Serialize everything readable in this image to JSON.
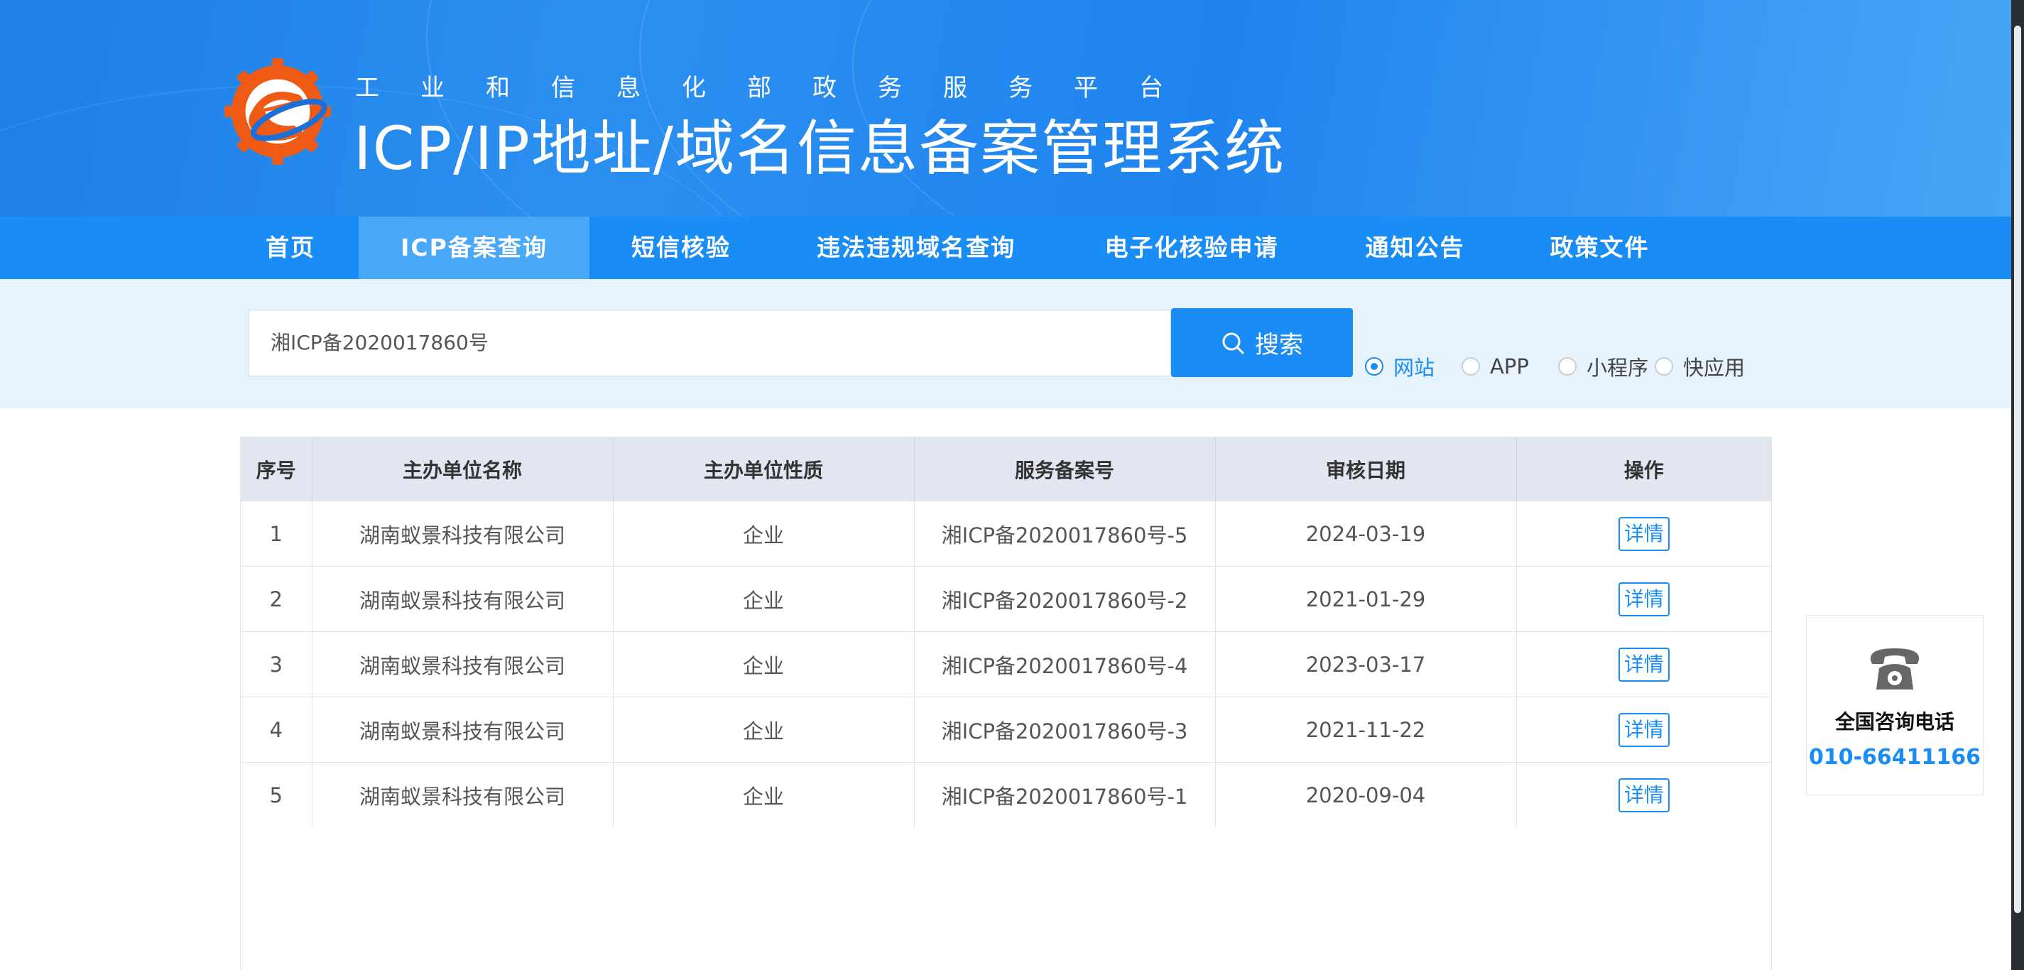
{
  "header": {
    "subtitle": "工业和信息化部政务服务平台",
    "title": "ICP/IP地址/域名信息备案管理系统"
  },
  "nav": {
    "items": [
      {
        "label": "首页",
        "active": false
      },
      {
        "label": "ICP备案查询",
        "active": true
      },
      {
        "label": "短信核验",
        "active": false
      },
      {
        "label": "违法违规域名查询",
        "active": false
      },
      {
        "label": "电子化核验申请",
        "active": false
      },
      {
        "label": "通知公告",
        "active": false
      },
      {
        "label": "政策文件",
        "active": false
      }
    ]
  },
  "search": {
    "value": "湘ICP备2020017860号",
    "button_label": "搜索",
    "options": [
      {
        "label": "网站",
        "checked": true
      },
      {
        "label": "APP",
        "checked": false
      },
      {
        "label": "小程序",
        "checked": false
      },
      {
        "label": "快应用",
        "checked": false
      }
    ]
  },
  "table": {
    "headers": [
      "序号",
      "主办单位名称",
      "主办单位性质",
      "服务备案号",
      "审核日期",
      "操作"
    ],
    "rows": [
      {
        "index": "1",
        "org": "湖南蚁景科技有限公司",
        "type": "企业",
        "record": "湘ICP备2020017860号-5",
        "date": "2024-03-19",
        "action": "详情"
      },
      {
        "index": "2",
        "org": "湖南蚁景科技有限公司",
        "type": "企业",
        "record": "湘ICP备2020017860号-2",
        "date": "2021-01-29",
        "action": "详情"
      },
      {
        "index": "3",
        "org": "湖南蚁景科技有限公司",
        "type": "企业",
        "record": "湘ICP备2020017860号-4",
        "date": "2023-03-17",
        "action": "详情"
      },
      {
        "index": "4",
        "org": "湖南蚁景科技有限公司",
        "type": "企业",
        "record": "湘ICP备2020017860号-3",
        "date": "2021-11-22",
        "action": "详情"
      },
      {
        "index": "5",
        "org": "湖南蚁景科技有限公司",
        "type": "企业",
        "record": "湘ICP备2020017860号-1",
        "date": "2020-09-04",
        "action": "详情"
      }
    ]
  },
  "consult": {
    "title": "全国咨询电话",
    "phone": "010-66411166",
    "icon": "telephone-icon"
  },
  "colors": {
    "primary": "#1a8cf5",
    "header_bg": "#2b8ff0",
    "nav_active": "#4aa8f8",
    "search_band": "#e6f3fd",
    "table_header": "#e2e6f0",
    "logo_orange": "#f0601a"
  }
}
